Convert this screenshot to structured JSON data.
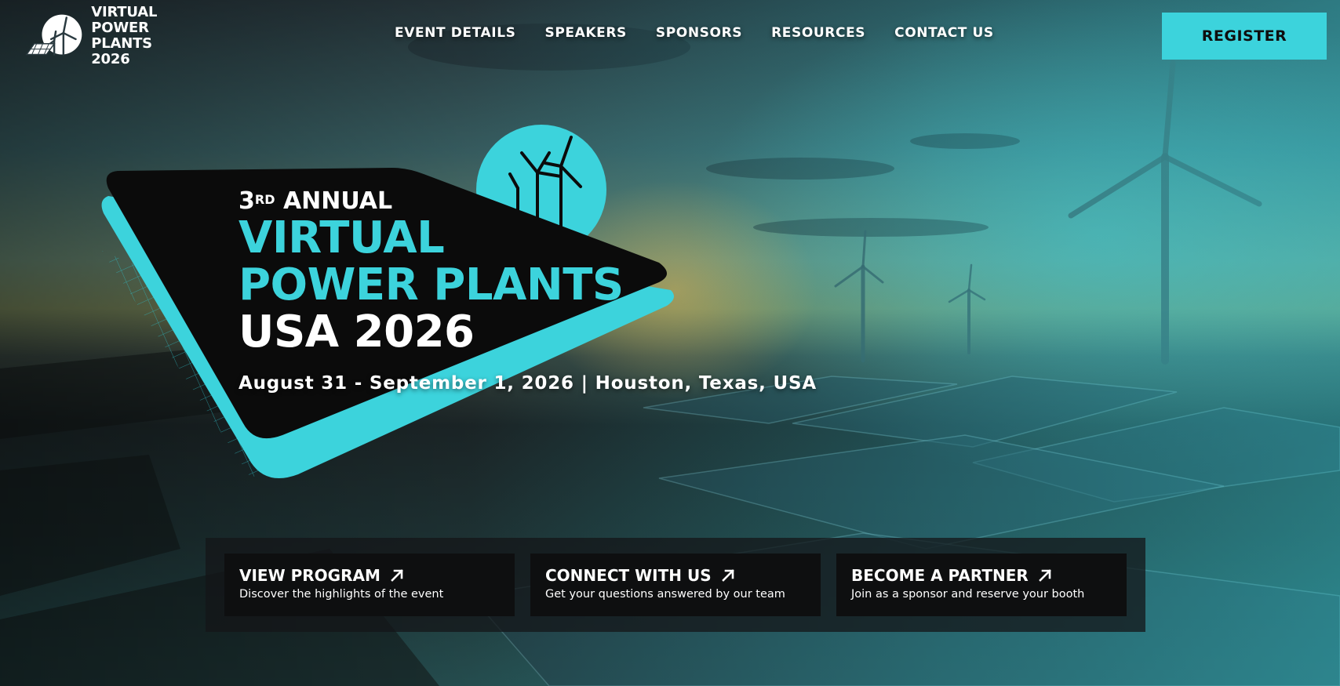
{
  "brand": {
    "logo_lines": [
      "VIRTUAL",
      "POWER PLANTS",
      "2026"
    ],
    "accent_color": "#3cd3dc"
  },
  "nav": {
    "items": [
      "EVENT DETAILS",
      "SPEAKERS",
      "SPONSORS",
      "RESOURCES",
      "CONTACT US"
    ],
    "register_label": "REGISTER"
  },
  "hero": {
    "edition_number": "3",
    "edition_suffix": "RD",
    "edition_word": "ANNUAL",
    "title_line1": "VIRTUAL",
    "title_line2": "POWER PLANTS",
    "title_line3": "USA 2026",
    "date_location": "August 31 - September 1, 2026 | Houston, Texas, USA"
  },
  "cta": [
    {
      "title": "VIEW PROGRAM",
      "description": "Discover the highlights of the event"
    },
    {
      "title": "CONNECT WITH US",
      "description": "Get your questions answered by our team"
    },
    {
      "title": "BECOME A PARTNER",
      "description": "Join as a sponsor and reserve your booth"
    }
  ]
}
